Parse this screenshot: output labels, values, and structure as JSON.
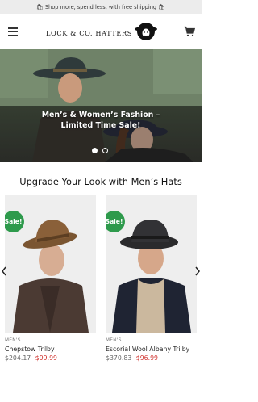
{
  "announcement": {
    "text": "Shop more, spend less, with free shipping",
    "icon": "shopping-bag-icon"
  },
  "header": {
    "logo_text": "LOCK & CO. HATTERS",
    "menu_icon": "hamburger-menu-icon",
    "cart_icon": "cart-icon"
  },
  "hero": {
    "caption_line1": "Men’s & Women’s Fashion –",
    "caption_line2": "Limited Time Sale!",
    "slides": 2,
    "active_slide": 1
  },
  "section": {
    "title": "Upgrade Your Look with Men’s Hats"
  },
  "products": [
    {
      "badge": "Sale!",
      "category": "MEN'S",
      "name": "Chepstow Trilby",
      "old_price": "$204.17",
      "new_price": "$99.99"
    },
    {
      "badge": "Sale!",
      "category": "MEN'S",
      "name": "Escorial Wool Albany Trilby",
      "old_price": "$370.83",
      "new_price": "$96.99"
    }
  ],
  "colors": {
    "sale_badge": "#2e9a4c",
    "sale_price": "#d0312d",
    "announcement_bg": "#ececec"
  }
}
